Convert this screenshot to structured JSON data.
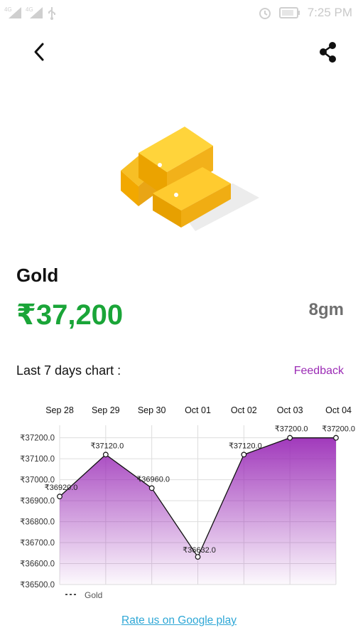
{
  "status_bar": {
    "signal_1": "4G",
    "signal_2": "4G",
    "time": "7:25 PM"
  },
  "header": {
    "back_icon": "chevron-left-icon",
    "share_icon": "share-icon"
  },
  "product": {
    "name": "Gold",
    "price": "₹37,200",
    "weight": "8gm",
    "image_icon": "gold-bars-icon"
  },
  "chart_section": {
    "title": "Last 7 days chart :",
    "feedback_label": "Feedback"
  },
  "chart_data": {
    "type": "area",
    "categories": [
      "Sep 28",
      "Sep 29",
      "Sep 30",
      "Oct 01",
      "Oct 02",
      "Oct 03",
      "Oct 04"
    ],
    "series": [
      {
        "name": "Gold",
        "values": [
          36920.0,
          37120.0,
          36960.0,
          36632.0,
          37120.0,
          37200.0,
          37200.0
        ]
      }
    ],
    "data_labels": [
      "₹36920.0",
      "₹37120.0",
      "₹36960.0",
      "₹36632.0",
      "₹37120.0",
      "₹37200.0",
      "₹37200.0"
    ],
    "y_ticks": [
      36500.0,
      36600.0,
      36700.0,
      36800.0,
      36900.0,
      37000.0,
      37100.0,
      37200.0
    ],
    "y_tick_labels": [
      "₹36500.0",
      "₹36600.0",
      "₹36700.0",
      "₹36800.0",
      "₹36900.0",
      "₹37000.0",
      "₹37100.0",
      "₹37200.0"
    ],
    "ylim": [
      36500,
      37260
    ],
    "grid": true,
    "legend_position": "bottom-left",
    "fill_color": "#9c2fb8",
    "line_color": "#111111"
  },
  "footer": {
    "rate_label": "Rate us on Google play"
  }
}
